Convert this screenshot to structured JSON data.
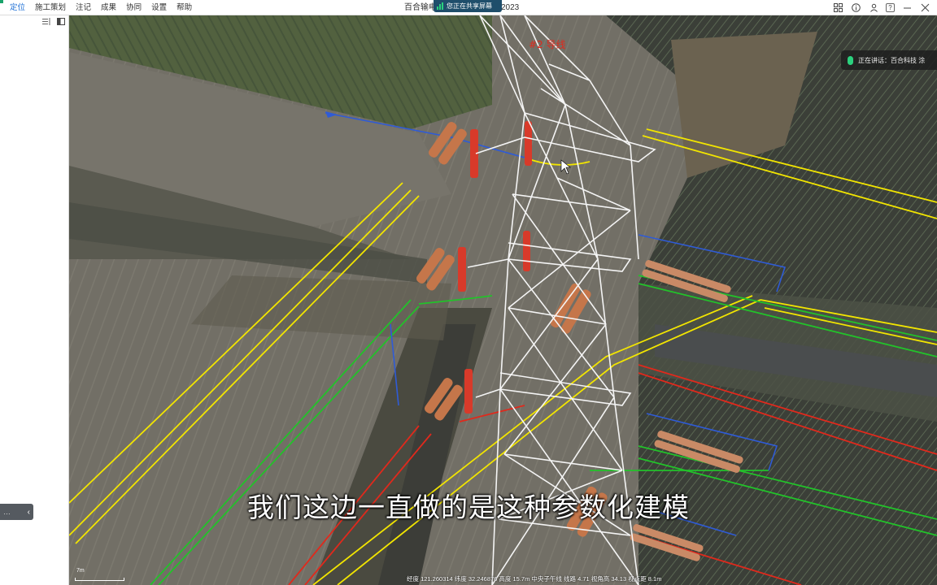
{
  "menu": {
    "items": [
      {
        "label": "定位",
        "active": true
      },
      {
        "label": "施工策划",
        "active": false
      },
      {
        "label": "注记",
        "active": false
      },
      {
        "label": "成果",
        "active": false
      },
      {
        "label": "协同",
        "active": false
      },
      {
        "label": "设置",
        "active": false
      },
      {
        "label": "帮助",
        "active": false
      }
    ]
  },
  "window": {
    "title": "百合输电",
    "title_suffix": "2023",
    "share_banner": "您正在共享屏幕",
    "controls": [
      "grid-icon",
      "info-icon",
      "user-icon",
      "help-icon",
      "minimize-icon",
      "close-icon"
    ],
    "help_glyph": "?"
  },
  "speaker": {
    "text": "正在讲话：百合科技 涂"
  },
  "subtitle": "我们这边一直做的是这种参数化建模",
  "status": {
    "text": "经度 121.260314  纬度 32.246876  高度 15.7m  中央子午线  线路 4.71  视角高 34.13  视点距 8.1m"
  },
  "scale": {
    "label": "7m"
  },
  "scene_labels": {
    "top_red": "#2 导线"
  },
  "colors": {
    "accent_green": "#1aa36b",
    "menu_active": "#1d6fd6",
    "wire_yellow": "#f2e500",
    "wire_green": "#22c22a",
    "wire_red": "#e0291c",
    "wire_blue": "#2f5bd6",
    "insulator": "#c5764a",
    "tower": "#f4f4f4"
  }
}
